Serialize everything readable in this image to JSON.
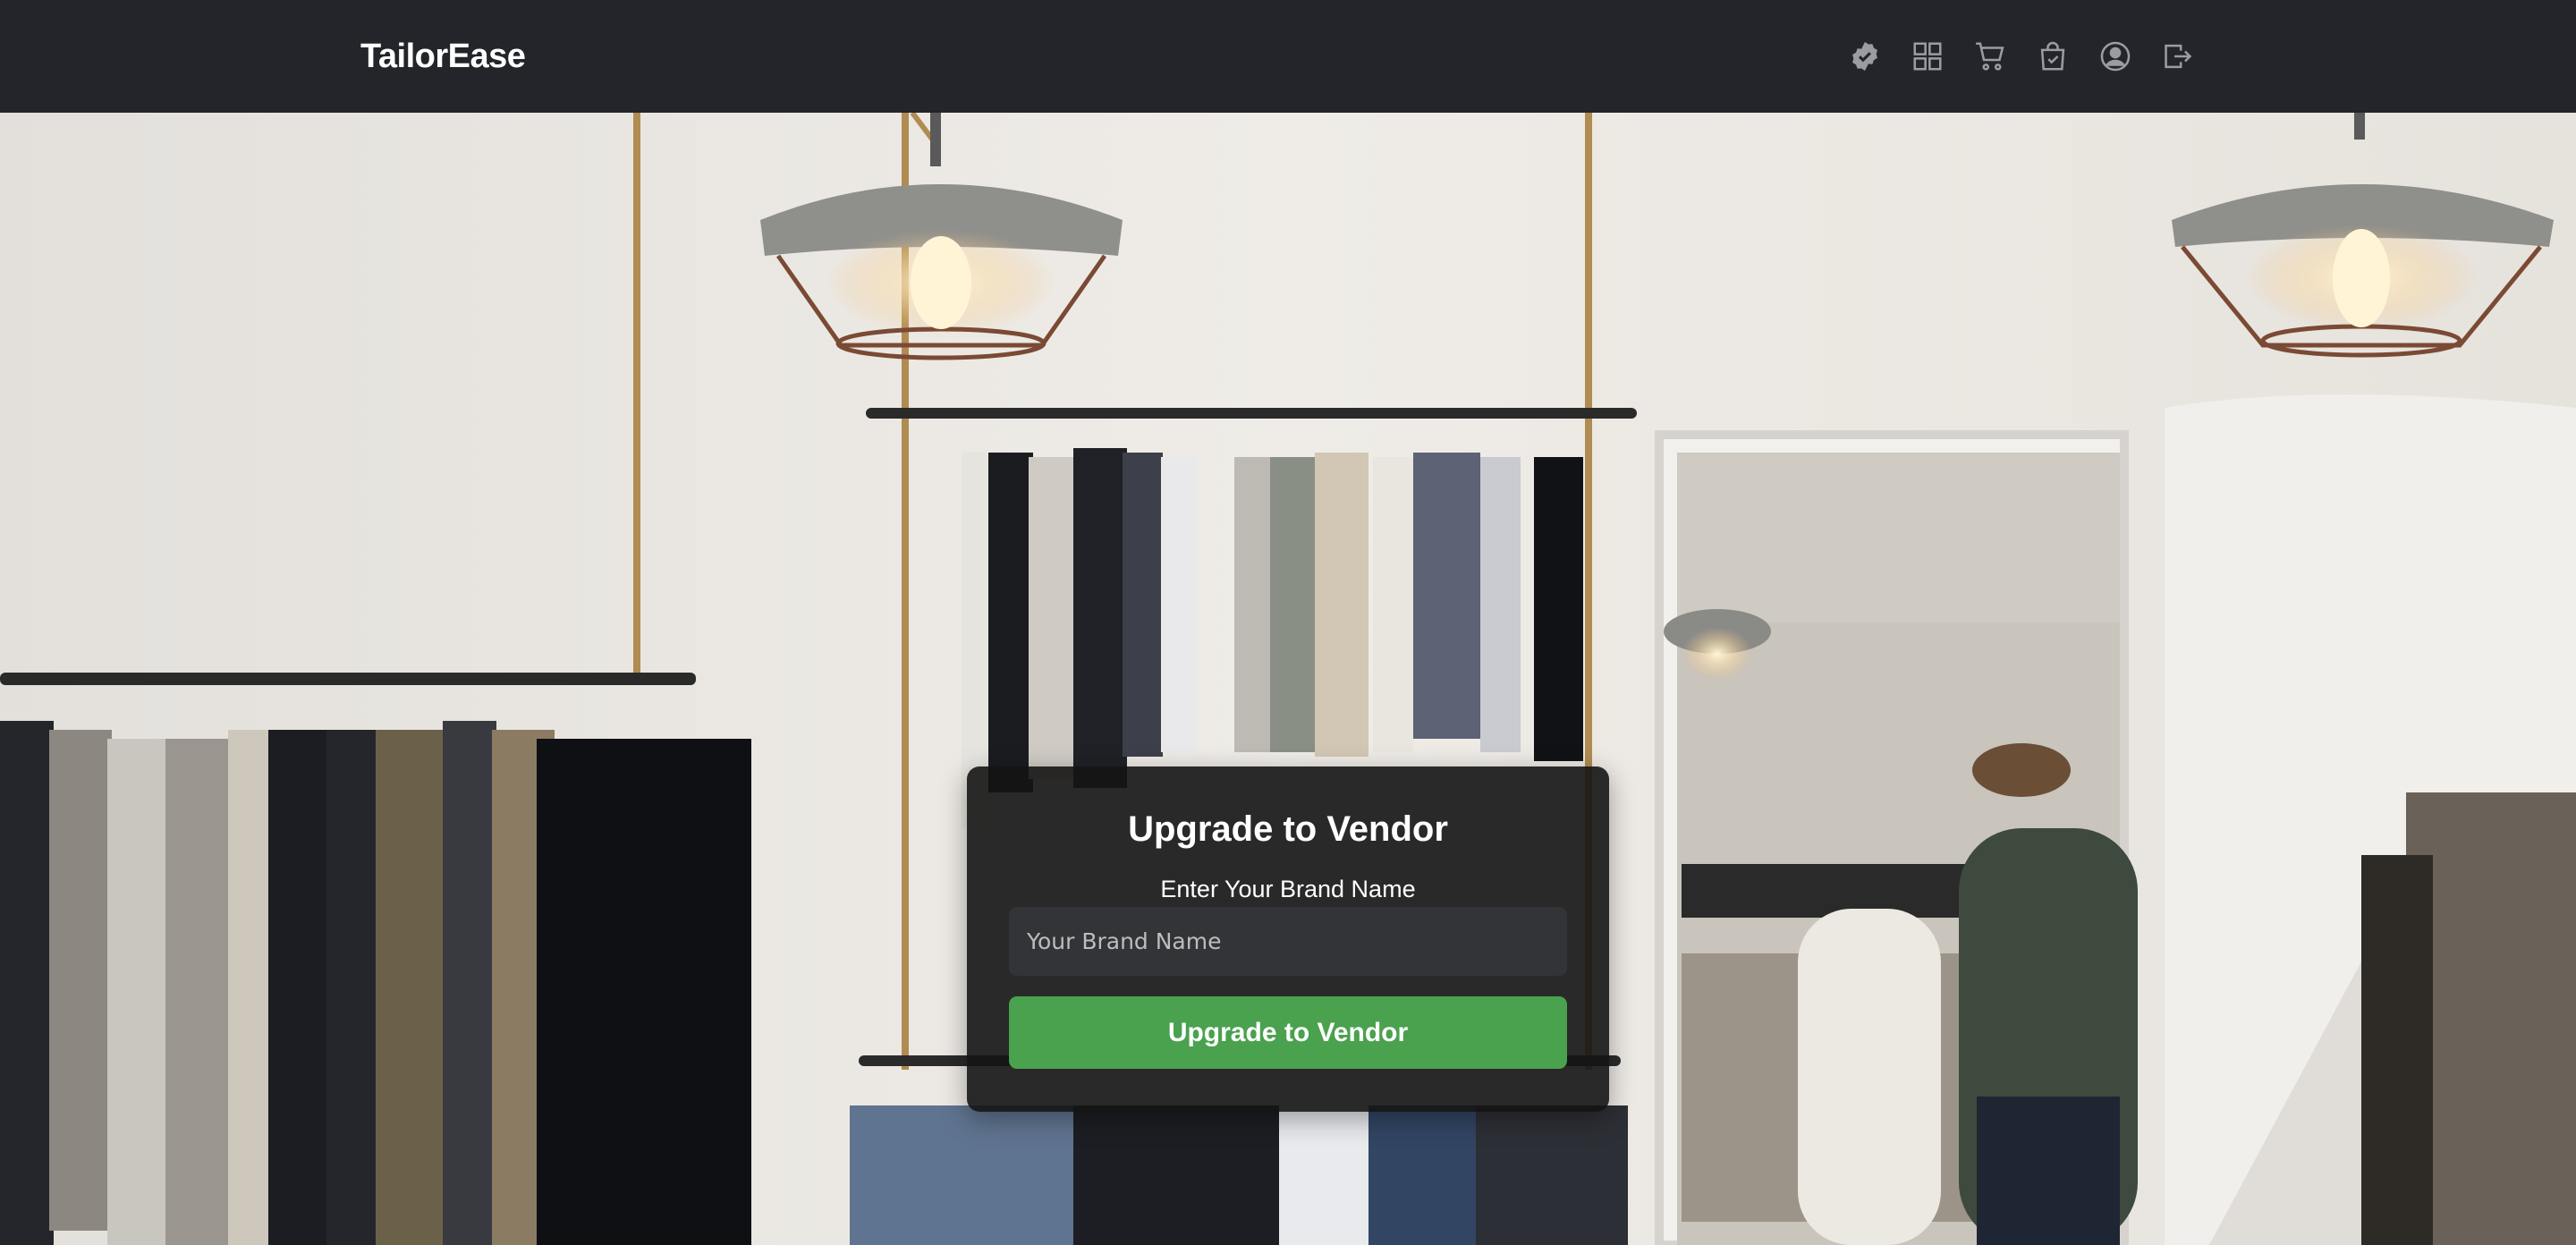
{
  "navbar": {
    "brand": "TailorEase",
    "icons": [
      {
        "name": "verified-badge-icon"
      },
      {
        "name": "grid-dashboard-icon"
      },
      {
        "name": "cart-icon"
      },
      {
        "name": "shopping-bag-check-icon"
      },
      {
        "name": "user-profile-icon"
      },
      {
        "name": "logout-icon"
      }
    ]
  },
  "upgrade_form": {
    "title": "Upgrade to Vendor",
    "label": "Enter Your Brand Name",
    "input_placeholder": "Your Brand Name",
    "input_value": "",
    "submit_label": "Upgrade to Vendor"
  },
  "colors": {
    "navbar_bg": "#23252a",
    "button_bg": "#4aa14e",
    "card_bg": "rgba(20,20,20,0.9)"
  }
}
